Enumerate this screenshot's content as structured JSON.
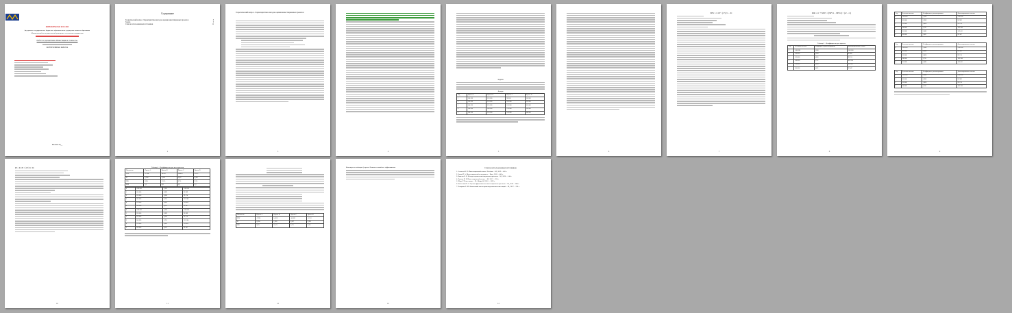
{
  "document": {
    "page_numbers": [
      "2",
      "3",
      "4",
      "5",
      "6",
      "7",
      "8",
      "9",
      "10",
      "11",
      "12"
    ],
    "cover": {
      "ministry": "МИНОБРНАУКИ РОССИИ",
      "university_line1": "федеральное государственное бюджетное образовательное учреждение высшего образования",
      "university_line2": "«Национальный исследовательский университет технологии и управления»",
      "work_title": "Работа по дисциплине «Инвестиции и стоимость»",
      "work_type": "КОНТРОЛЬНАЯ РАБОТА",
      "city": "Москва 20__"
    },
    "toc": {
      "title": "Содержание",
      "items": [
        "Теоретический вопрос. Характеристика методов оценки инвестиционных проектов",
        "Задача",
        "Список использованных источников"
      ],
      "pages": [
        "3",
        "5",
        "11"
      ]
    },
    "page3_heading": "Теоретический вопрос. Характеристика методов оценки инвестиционных проектов",
    "page7_heading": "Задача",
    "table_income": {
      "caption": "Доходы",
      "headers": [
        "Год",
        "Проект A",
        "Проект B",
        "Проект C",
        "Проект D"
      ],
      "rows": [
        [
          "1",
          "100 000",
          "120 000",
          "90 000",
          "110 000"
        ],
        [
          "2",
          "120 000",
          "130 000",
          "100 000",
          "115 000"
        ],
        [
          "3",
          "140 000",
          "135 000",
          "120 000",
          "125 000"
        ],
        [
          "4",
          "150 000",
          "140 000",
          "130 000",
          "130 000"
        ],
        [
          "5",
          "160 000",
          "150 000",
          "145 000",
          "140 000"
        ]
      ]
    },
    "page8_formula": "NPV = Σ CF / (1+r)^t − IC",
    "page9_formula": "IRR = r1 + NPV1 / (NPV1 − NPV2) × (r2 − r1)",
    "table_8": {
      "caption": "Таблица 3 – Коэффициенты для проекта",
      "headers": [
        "Год",
        "Денежные потоки",
        "Коэффициент дисконтирования",
        "Дисконтированные потоки"
      ],
      "rows": [
        [
          "0",
          "-500 000",
          "1,000",
          "-500 000"
        ],
        [
          "1",
          "100 000",
          "0,909",
          "90 909"
        ],
        [
          "2",
          "120 000",
          "0,826",
          "99 174"
        ],
        [
          "3",
          "140 000",
          "0,751",
          "105 184"
        ],
        [
          "4",
          "150 000",
          "0,683",
          "102 452"
        ],
        [
          "5",
          "160 000",
          "0,621",
          "99 347"
        ]
      ]
    },
    "page10_formula": "PI = Σ CF / (1+r)^t / IC",
    "page11_table": {
      "caption": "Таблица 4 – Коэффициенты для всех проектов",
      "headers": [
        "Показатель",
        "Проект A",
        "Проект B",
        "Проект C",
        "Проект D"
      ],
      "rows": [
        [
          "NPV",
          "-2 934",
          "14 052",
          "-46 420",
          "-8 512"
        ],
        [
          "PI",
          "0,994",
          "1,028",
          "0,907",
          "0,983"
        ],
        [
          "IRR",
          "9,8%",
          "11,1%",
          "6,7%",
          "9,3%"
        ],
        [
          "DPP",
          "5,1",
          "4,8",
          "5,9",
          "5,2"
        ]
      ]
    },
    "page12_heading": "Список использованных источников",
    "page12_note": "Как видно из таблицы 4, проект B является наиболее эффективным.",
    "sources": [
      "1. Алексеев В. Н. Инвестиционный анализ. Учебник. – М., 2019. – 416 с.",
      "2. Бланк И. А. Инвестиционный менеджмент. – Киев, 2018. – 448 с.",
      "3. Ковалев В. В. Методы оценки инвестиционных проектов. – М., 2020. – 144 с.",
      "4. Липсиц И. В. Инвестиционный анализ. – М., 2017. – 320 с.",
      "5. Шарп У. Инвестиции. – М.: Инфра-М, 2016. – 1028 с.",
      "6. Виленский П. Л. Оценка эффективности инвестиционных проектов. – М., 2018. – 888 с.",
      "7. Четыркин Е. М. Финансовый анализ производственных инвестиций. – М., 2017. – 256 с."
    ],
    "colors": {
      "highlight_red": "#cc0000",
      "highlight_blue": "#2040c0",
      "highlight_green": "#1a8a1a",
      "page_bg": "#ffffff",
      "viewer_bg": "#a9a9a9"
    }
  }
}
